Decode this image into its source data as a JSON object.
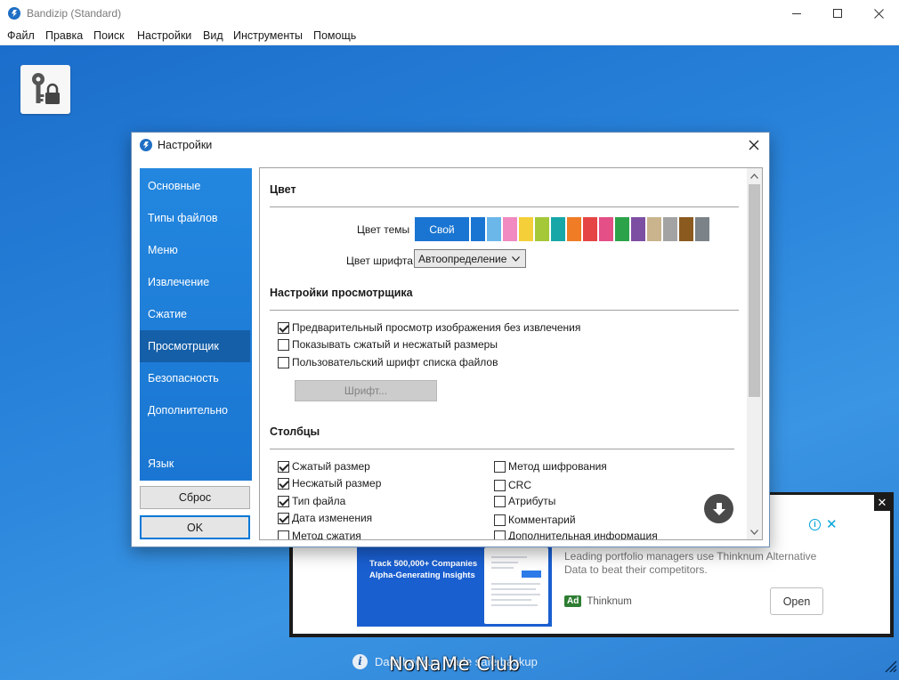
{
  "window": {
    "title": "Bandizip (Standard)",
    "menu": [
      "Файл",
      "Правка",
      "Поиск",
      "Настройки",
      "Вид",
      "Инструменты",
      "Помощь"
    ]
  },
  "dialog": {
    "title": "Настройки",
    "nav": [
      "Основные",
      "Типы файлов",
      "Меню",
      "Извлечение",
      "Сжатие",
      "Просмотрщик",
      "Безопасность",
      "Дополнительно",
      "Язык"
    ],
    "active_nav": "Просмотрщик",
    "reset_label": "Сброс",
    "ok_label": "OK",
    "color_section": {
      "title": "Цвет",
      "theme_label": "Цвет темы",
      "own_label": "Свой",
      "swatches": [
        "#1a75d2",
        "#6cb7ea",
        "#f08ac0",
        "#f4cf3a",
        "#a4c838",
        "#17a7a7",
        "#f07c25",
        "#e54545",
        "#e34f86",
        "#2ca34a",
        "#7d4fa3",
        "#c9b48d",
        "#a3a3a3",
        "#8a5a1f",
        "#7b8388"
      ],
      "font_color_label": "Цвет шрифта",
      "font_color_value": "Автоопределение"
    },
    "viewer_section": {
      "title": "Настройки просмотрщика",
      "options": [
        {
          "label": "Предварительный просмотр изображения без извлечения",
          "checked": true
        },
        {
          "label": "Показывать сжатый и несжатый размеры",
          "checked": false
        },
        {
          "label": "Пользовательский шрифт списка файлов",
          "checked": false
        }
      ],
      "font_button": "Шрифт..."
    },
    "columns_section": {
      "title": "Столбцы",
      "left": [
        {
          "label": "Сжатый размер",
          "checked": true
        },
        {
          "label": "Несжатый размер",
          "checked": true
        },
        {
          "label": "Тип файла",
          "checked": true
        },
        {
          "label": "Дата изменения",
          "checked": true
        },
        {
          "label": "Метод сжатия",
          "checked": false
        }
      ],
      "right": [
        {
          "label": "Метод шифрования",
          "checked": false
        },
        {
          "label": "CRC",
          "checked": false
        },
        {
          "label": "Атрибуты",
          "checked": false
        },
        {
          "label": "Комментарий",
          "checked": false
        },
        {
          "label": "Дополнительная информация",
          "checked": false
        }
      ]
    }
  },
  "ad": {
    "thumb_title": "Track 500,000+ Companies Alpha-Generating Insights",
    "text": "Leading portfolio managers use Thinknum Alternative Data to beat their competitors.",
    "ad_tag": "Ad",
    "advertiser": "Thinknum",
    "open_label": "Open"
  },
  "status": {
    "info_icon": "i",
    "text": "Data backup made safe backup"
  },
  "watermark": "NoNaMe Club",
  "icons": {
    "app": "bandizip-logo-icon",
    "key": "key-lock-icon",
    "download": "download-arrow-icon"
  }
}
